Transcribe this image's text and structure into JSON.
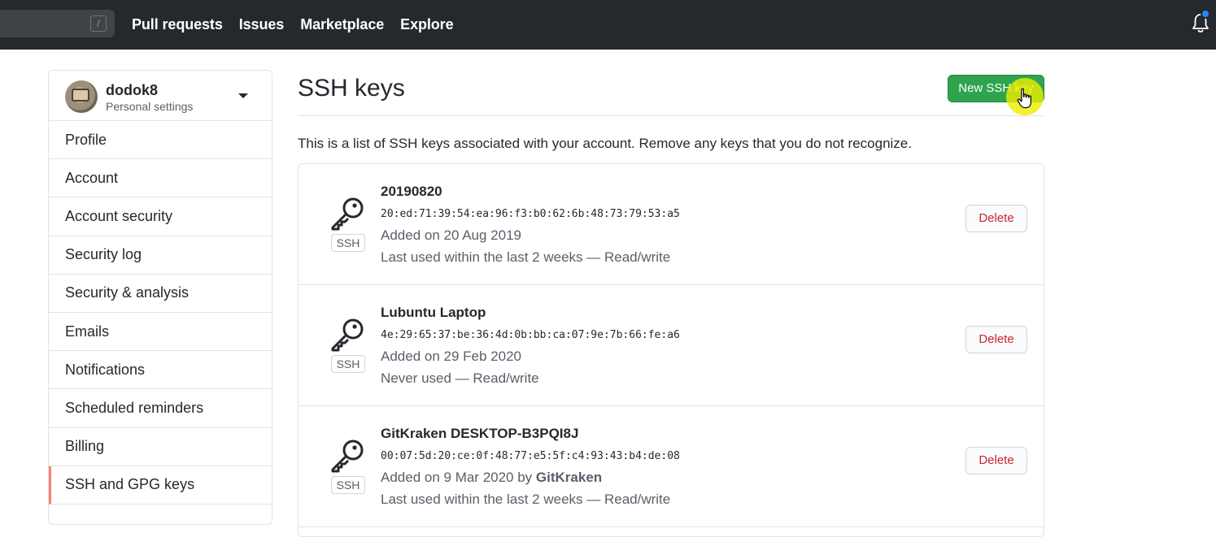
{
  "header": {
    "search_shortcut": "/",
    "nav": [
      "Pull requests",
      "Issues",
      "Marketplace",
      "Explore"
    ],
    "notification_icon": "bell-icon",
    "notification_dot_color": "#2188ff"
  },
  "sidebar": {
    "username": "dodok8",
    "subtitle": "Personal settings",
    "items": [
      {
        "label": "Profile"
      },
      {
        "label": "Account"
      },
      {
        "label": "Account security"
      },
      {
        "label": "Security log"
      },
      {
        "label": "Security & analysis"
      },
      {
        "label": "Emails"
      },
      {
        "label": "Notifications"
      },
      {
        "label": "Scheduled reminders"
      },
      {
        "label": "Billing"
      },
      {
        "label": "SSH and GPG keys",
        "active": true
      }
    ],
    "active_accent": "#f9826c"
  },
  "main": {
    "title": "SSH keys",
    "new_button": "New SSH key",
    "new_button_color": "#2ea44f",
    "description": "This is a list of SSH keys associated with your account. Remove any keys that you do not recognize.",
    "keys": [
      {
        "title": "20190820",
        "fingerprint": "20:ed:71:39:54:ea:96:f3:b0:62:6b:48:73:79:53:a5",
        "added": "Added on 20 Aug 2019",
        "added_by": "",
        "used": "Last used within the last 2 weeks — Read/write",
        "badge": "SSH",
        "delete": "Delete"
      },
      {
        "title": "Lubuntu Laptop",
        "fingerprint": "4e:29:65:37:be:36:4d:0b:bb:ca:07:9e:7b:66:fe:a6",
        "added": "Added on 29 Feb 2020",
        "added_by": "",
        "used": "Never used — Read/write",
        "badge": "SSH",
        "delete": "Delete"
      },
      {
        "title": "GitKraken DESKTOP-B3PQI8J",
        "fingerprint": "00:07:5d:20:ce:0f:48:77:e5:5f:c4:93:43:b4:de:08",
        "added": "Added on 9 Mar 2020 by",
        "added_by": "GitKraken",
        "used": "Last used within the last 2 weeks — Read/write",
        "badge": "SSH",
        "delete": "Delete"
      }
    ]
  }
}
